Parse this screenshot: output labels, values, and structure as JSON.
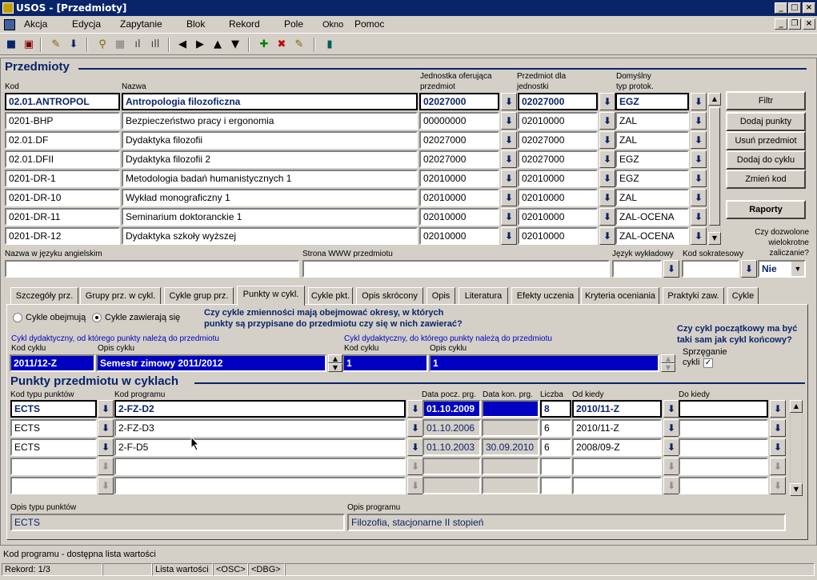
{
  "window": {
    "title": "USOS - [Przedmioty]"
  },
  "menu": {
    "items": [
      "Akcja",
      "Edycja",
      "Zapytanie",
      "Blok",
      "Rekord",
      "Pole",
      "Okno",
      "Pomoc"
    ]
  },
  "toolbar": {
    "icons": [
      "save-icon",
      "print-icon",
      "edit-icon",
      "download-icon",
      "query-icon",
      "grid-icon",
      "chart-icon",
      "bars-icon",
      "prev-icon",
      "next-icon",
      "up-icon",
      "down-icon",
      "insert-icon",
      "delete-icon",
      "clear-icon",
      "exit-icon"
    ]
  },
  "przedmioty": {
    "title": "Przedmioty",
    "headers": {
      "kod": "Kod",
      "nazwa": "Nazwa",
      "jedn1": "Jednostka oferująca",
      "jedn2": "przedmiot",
      "dla1": "Przedmiot dla",
      "dla2": "jednostki",
      "typ1": "Domyślny",
      "typ2": "typ protok."
    },
    "rows": [
      {
        "kod": "02.01.ANTROPOL",
        "nazwa": "Antropologia filozoficzna",
        "jedn": "02027000",
        "dla": "02027000",
        "typ": "EGZ"
      },
      {
        "kod": "0201-BHP",
        "nazwa": "Bezpieczeństwo pracy i ergonomia",
        "jedn": "00000000",
        "dla": "02010000",
        "typ": "ZAL"
      },
      {
        "kod": "02.01.DF",
        "nazwa": "Dydaktyka filozofii",
        "jedn": "02027000",
        "dla": "02027000",
        "typ": "ZAL"
      },
      {
        "kod": "02.01.DFII",
        "nazwa": "Dydaktyka filozofii 2",
        "jedn": "02027000",
        "dla": "02027000",
        "typ": "EGZ"
      },
      {
        "kod": "0201-DR-1",
        "nazwa": "Metodologia badań humanistycznych 1",
        "jedn": "02010000",
        "dla": "02010000",
        "typ": "EGZ"
      },
      {
        "kod": "0201-DR-10",
        "nazwa": "Wykład monograficzny 1",
        "jedn": "02010000",
        "dla": "02010000",
        "typ": "ZAL"
      },
      {
        "kod": "0201-DR-11",
        "nazwa": "Seminarium doktoranckie 1",
        "jedn": "02010000",
        "dla": "02010000",
        "typ": "ZAL-OCENA"
      },
      {
        "kod": "0201-DR-12",
        "nazwa": "Dydaktyka szkoły wyższej",
        "jedn": "02010000",
        "dla": "02010000",
        "typ": "ZAL-OCENA"
      }
    ],
    "buttons": {
      "filtr": "Filtr",
      "dodaj_punkty": "Dodaj punkty",
      "usun": "Usuń przedmiot",
      "dodaj_cykl": "Dodaj do cyklu",
      "zmien": "Zmień kod",
      "raporty": "Raporty"
    },
    "wielokrotne": {
      "l1": "Czy dozwolone",
      "l2": "wielokrotne",
      "l3": "zaliczanie?",
      "value": "Nie"
    },
    "labels": {
      "ang": "Nazwa w języku angielskim",
      "www": "Strona WWW  przedmiotu",
      "jezyk": "Język wykładowy",
      "sokr": "Kod sokratesowy"
    }
  },
  "tabs": [
    "Szczegóły prz.",
    "Grupy prz. w cykl.",
    "Cykle grup prz.",
    "Punkty w cykl.",
    "Cykle pkt.",
    "Opis skrócony",
    "Opis",
    "Literatura",
    "Efekty uczenia",
    "Kryteria oceniania",
    "Praktyki zaw.",
    "Cykle"
  ],
  "punkty_tab": {
    "radio1": "Cykle obejmują",
    "radio2": "Cykle zawierają się",
    "question1": "Czy cykle zmienności mają obejmować okresy, w których",
    "question2": "punkty są przypisane do przedmiotu czy się w nich zawierać?",
    "question3": "Czy cykl początkowy ma być",
    "question4": "taki sam jak cykl końcowy?",
    "sprzeganie1": "Sprzęganie",
    "sprzeganie2": "cykli",
    "cykl_od_label": "Cykl dydaktyczny, od którego punkty należą do przedmiotu",
    "cykl_do_label": "Cykl dydaktyczny, do którego punkty należą do przedmiotu",
    "kod_cyklu": "Kod cyklu",
    "opis_cyklu": "Opis cyklu",
    "cykl_od_kod": "2011/12-Z",
    "cykl_od_opis": "Semestr zimowy 2011/2012",
    "cykl_do_kod": "1",
    "cykl_do_opis": "1"
  },
  "punkty": {
    "title": "Punkty przedmiotu w cyklach",
    "headers": {
      "typ": "Kod typu punktów",
      "prog": "Kod programu",
      "pocz": "Data pocz. prg.",
      "kon": "Data kon. prg.",
      "liczba": "Liczba",
      "od": "Od kiedy",
      "do": "Do kiedy"
    },
    "rows": [
      {
        "typ": "ECTS",
        "prog": "2-FZ-D2",
        "pocz": "01.10.2009",
        "kon": "",
        "liczba": "8",
        "od": "2010/11-Z",
        "do": ""
      },
      {
        "typ": "ECTS",
        "prog": "2-FZ-D3",
        "pocz": "01.10.2006",
        "kon": "",
        "liczba": "6",
        "od": "2010/11-Z",
        "do": ""
      },
      {
        "typ": "ECTS",
        "prog": "2-F-D5",
        "pocz": "01.10.2003",
        "kon": "30.09.2010",
        "liczba": "6",
        "od": "2008/09-Z",
        "do": ""
      },
      {
        "typ": "",
        "prog": "",
        "pocz": "",
        "kon": "",
        "liczba": "",
        "od": "",
        "do": ""
      },
      {
        "typ": "",
        "prog": "",
        "pocz": "",
        "kon": "",
        "liczba": "",
        "od": "",
        "do": ""
      }
    ],
    "opis_typu_label": "Opis typu punktów",
    "opis_prog_label": "Opis programu",
    "opis_typu": "ECTS",
    "opis_prog": "Filozofia, stacjonarne II stopień"
  },
  "status": {
    "hint": "Kod programu - dostępna lista wartości",
    "rekord": "Rekord: 1/3",
    "lista": "Lista wartości",
    "osc": "<OSC>",
    "dbg": "<DBG>"
  }
}
